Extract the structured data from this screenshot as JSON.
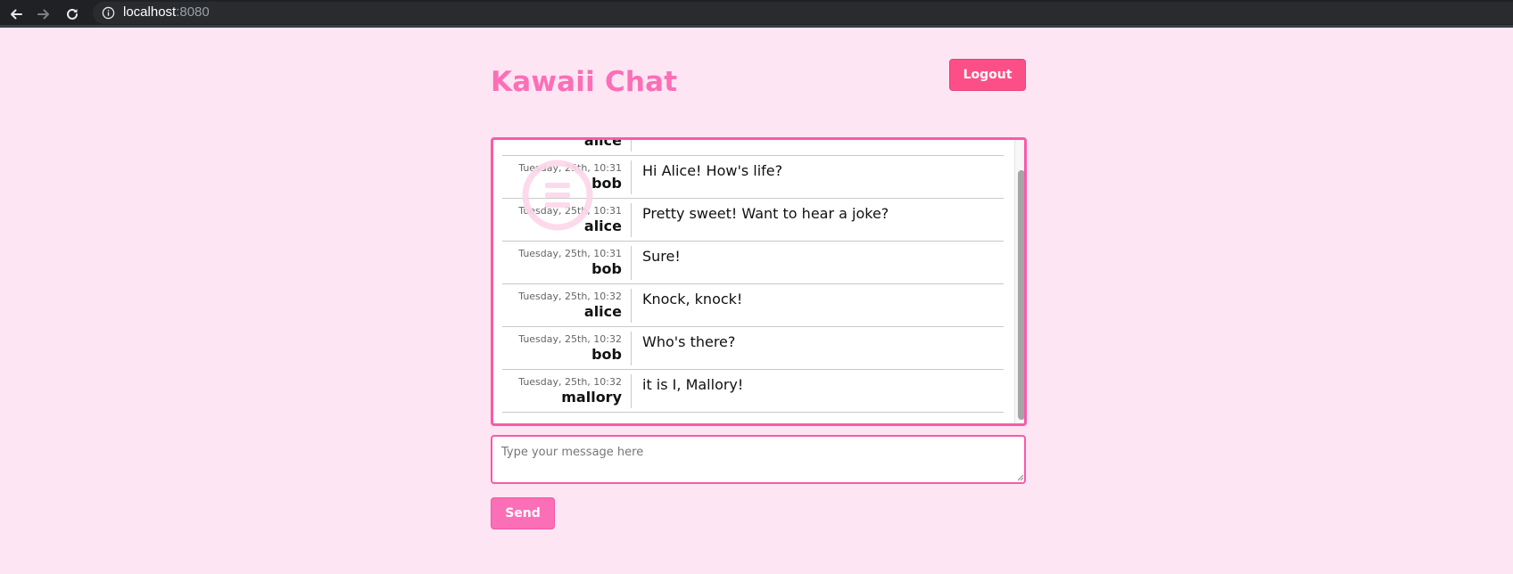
{
  "browser": {
    "url_host": "localhost",
    "url_port": ":8080"
  },
  "header": {
    "title": "Kawaii Chat",
    "logout_label": "Logout"
  },
  "chat": {
    "messages": [
      {
        "time": "",
        "user": "alice",
        "text": ""
      },
      {
        "time": "Tuesday, 25th, 10:31",
        "user": "bob",
        "text": "Hi Alice! How's life?"
      },
      {
        "time": "Tuesday, 25th, 10:31",
        "user": "alice",
        "text": "Pretty sweet! Want to hear a joke?"
      },
      {
        "time": "Tuesday, 25th, 10:31",
        "user": "bob",
        "text": "Sure!"
      },
      {
        "time": "Tuesday, 25th, 10:32",
        "user": "alice",
        "text": "Knock, knock!"
      },
      {
        "time": "Tuesday, 25th, 10:32",
        "user": "bob",
        "text": "Who's there?"
      },
      {
        "time": "Tuesday, 25th, 10:32",
        "user": "mallory",
        "text": "it is I, Mallory!"
      }
    ]
  },
  "composer": {
    "placeholder": "Type your message here",
    "value": "",
    "send_label": "Send"
  },
  "colors": {
    "page_background": "#fde5f3",
    "accent_pink": "#fb6fb7",
    "logout_pink": "#fd4f87"
  },
  "icons": {
    "back": "back-arrow-icon",
    "forward": "forward-arrow-icon",
    "reload": "reload-icon",
    "info": "info-icon",
    "watermark": "menu-circle-watermark-icon"
  }
}
